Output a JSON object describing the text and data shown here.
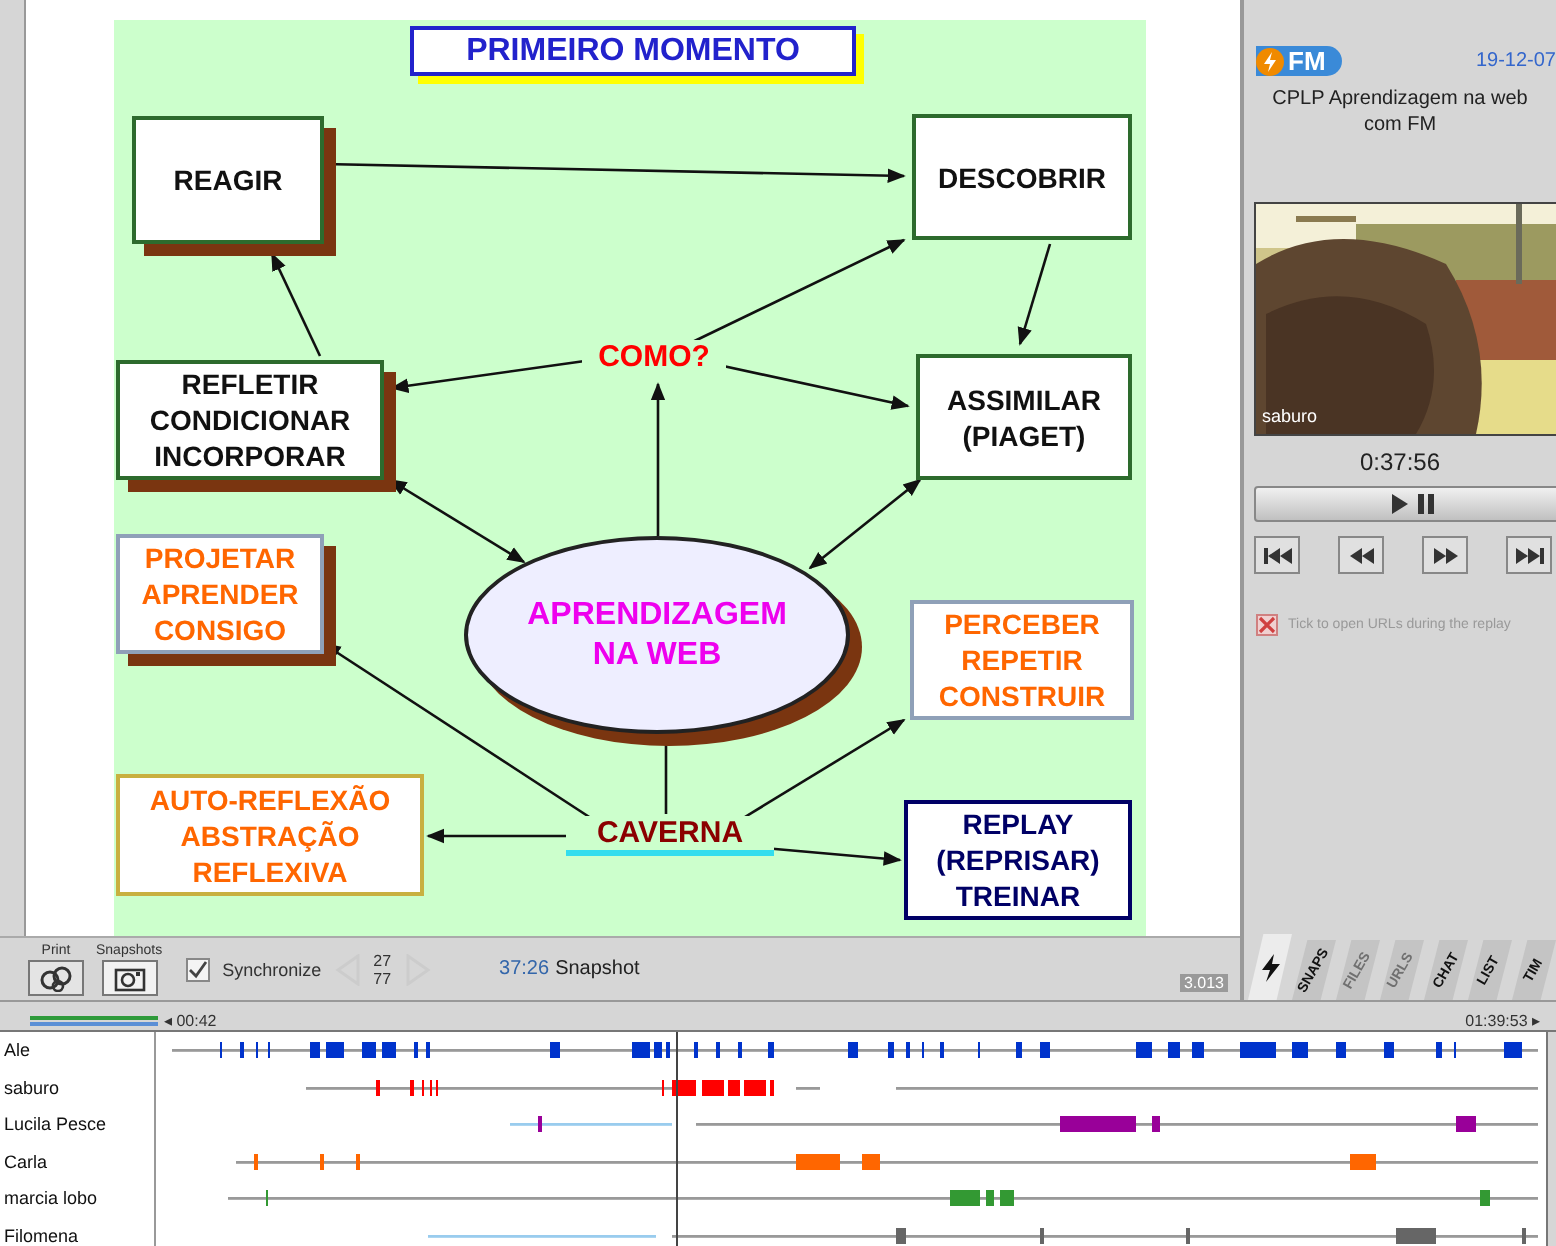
{
  "slide": {
    "title": "PRIMEIRO MOMENTO",
    "nodes": [
      {
        "kind": "box",
        "lines": [
          "REAGIR"
        ],
        "color": "#111111"
      },
      {
        "kind": "box",
        "lines": [
          "DESCOBRIR"
        ],
        "color": "#111111"
      },
      {
        "kind": "box",
        "lines": [
          "REFLETIR",
          "CONDICIONAR",
          "INCORPORAR"
        ],
        "color": "#111111"
      },
      {
        "kind": "label",
        "lines": [
          "COMO?"
        ],
        "color": "#ff0000"
      },
      {
        "kind": "box",
        "lines": [
          "ASSIMILAR",
          "(PIAGET)"
        ],
        "color": "#111111"
      },
      {
        "kind": "box",
        "lines": [
          "PROJETAR",
          "APRENDER",
          "CONSIGO"
        ],
        "color": "#ff6600"
      },
      {
        "kind": "ellipse",
        "lines": [
          "APRENDIZAGEM",
          "NA WEB"
        ],
        "color": "#ee00ee"
      },
      {
        "kind": "box",
        "lines": [
          "PERCEBER",
          "REPETIR",
          "CONSTRUIR"
        ],
        "color": "#ff6600"
      },
      {
        "kind": "box",
        "lines": [
          "AUTO-REFLEXÃO",
          "ABSTRAÇÃO",
          "REFLEXIVA"
        ],
        "color": "#ff6600"
      },
      {
        "kind": "label",
        "lines": [
          "CAVERNA"
        ],
        "color": "#8b0000"
      },
      {
        "kind": "box",
        "lines": [
          "REPLAY",
          "(REPRISAR)",
          "TREINAR"
        ],
        "color": "#000066"
      }
    ]
  },
  "toolbar": {
    "print": "Print",
    "snapshots": "Snapshots",
    "synchronize": {
      "label": "Synchronize",
      "checked": true
    },
    "page_current": "27",
    "page_total": "77",
    "snapshot_time": "37:26",
    "snapshot_label": "Snapshot",
    "zoom": "3.013"
  },
  "player": {
    "logo": "FM",
    "date": "19-12-07",
    "title": "CPLP Aprendizagem na web com FM",
    "video_caption": "saburo",
    "time": "0:37:56",
    "open_urls": {
      "label": "Tick to open URLs during the replay",
      "disabled": true
    }
  },
  "tabs": [
    {
      "kind": "icon",
      "selected": true,
      "disabled": false
    },
    {
      "kind": "text",
      "label": "SNAPS",
      "selected": false,
      "disabled": false
    },
    {
      "kind": "text",
      "label": "FILES",
      "selected": false,
      "disabled": true
    },
    {
      "kind": "text",
      "label": "URLS",
      "selected": false,
      "disabled": true
    },
    {
      "kind": "text",
      "label": "CHAT",
      "selected": false,
      "disabled": false
    },
    {
      "kind": "text",
      "label": "LIST",
      "selected": false,
      "disabled": false
    },
    {
      "kind": "text",
      "label": "TIM",
      "selected": false,
      "disabled": false
    }
  ],
  "timeline": {
    "start": "◂ 00:42",
    "end": "01:39:53 ▸",
    "participants": [
      {
        "name": "Ale",
        "color": "#0033cc"
      },
      {
        "name": "saburo",
        "color": "#ff0000"
      },
      {
        "name": "Lucila Pesce",
        "color": "#990099"
      },
      {
        "name": "Carla",
        "color": "#ff6600"
      },
      {
        "name": "marcia lobo",
        "color": "#339933"
      },
      {
        "name": "Filomena",
        "color": "#666666"
      }
    ]
  }
}
